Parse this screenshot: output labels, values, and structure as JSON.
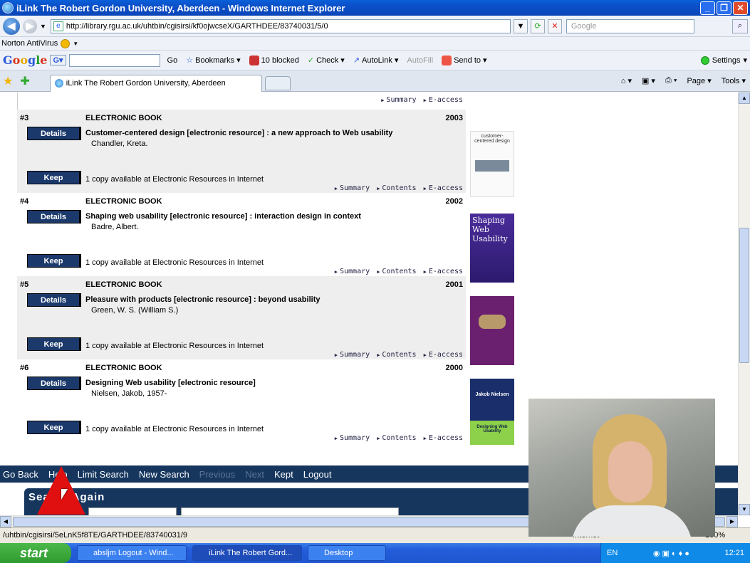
{
  "window": {
    "title": "iLink The Robert Gordon University, Aberdeen - Windows Internet Explorer"
  },
  "address": {
    "url": "http://library.rgu.ac.uk/uhtbin/cgisirsi/kf0ojwcseX/GARTHDEE/83740031/5/0",
    "search_placeholder": "Google"
  },
  "norton": {
    "label": "Norton AntiVirus"
  },
  "google_toolbar": {
    "go": "Go",
    "bookmarks": "Bookmarks",
    "blocked": "10 blocked",
    "check": "Check",
    "autolink": "AutoLink",
    "autofill": "AutoFill",
    "sendto": "Send to",
    "settings": "Settings"
  },
  "tab": {
    "label": "iLink The Robert Gordon University, Aberdeen"
  },
  "commandbar": {
    "page": "Page",
    "tools": "Tools"
  },
  "top_links": [
    "Summary",
    "E-access"
  ],
  "results": [
    {
      "num": "#3",
      "type": "ELECTRONIC BOOK",
      "year": "2003",
      "title": "Customer-centered design [electronic resource] : a new approach to Web usability",
      "author": "Chandler, Kreta.",
      "availability": "1 copy available at Electronic Resources in Internet",
      "links": [
        "Summary",
        "Contents",
        "E-access"
      ],
      "cover_text": "customer-centered design"
    },
    {
      "num": "#4",
      "type": "ELECTRONIC BOOK",
      "year": "2002",
      "title": "Shaping web usability [electronic resource] : interaction design in context",
      "author": "Badre, Albert.",
      "availability": "1 copy available at Electronic Resources in Internet",
      "links": [
        "Summary",
        "Contents",
        "E-access"
      ],
      "cover_text": "Shaping Web Usability"
    },
    {
      "num": "#5",
      "type": "ELECTRONIC BOOK",
      "year": "2001",
      "title": "Pleasure with products [electronic resource] : beyond usability",
      "author": "Green, W. S. (William S.)",
      "availability": "1 copy available at Electronic Resources in Internet",
      "links": [
        "Summary",
        "Contents",
        "E-access"
      ],
      "cover_text": ""
    },
    {
      "num": "#6",
      "type": "ELECTRONIC BOOK",
      "year": "2000",
      "title": "Designing Web usability [electronic resource]",
      "author": "Nielsen, Jakob, 1957-",
      "availability": "1 copy available at Electronic Resources in Internet",
      "links": [
        "Summary",
        "Contents",
        "E-access"
      ],
      "cover_text": "Jakob Nielsen",
      "cover_subtext": "Designing Web Usability"
    }
  ],
  "buttons": {
    "details": "Details",
    "keep": "Keep"
  },
  "nav": {
    "go_back": "Go Back",
    "help": "Help",
    "limit_search": "Limit Search",
    "new_search": "New Search",
    "previous": "Previous",
    "next": "Next",
    "kept": "Kept",
    "logout": "Logout"
  },
  "search_again": {
    "title": "Search Again"
  },
  "status": {
    "text": "/uhtbin/cgisirsi/5eLnK5f8TE/GARTHDEE/83740031/9",
    "zone": "Internet",
    "zoom": "100%"
  },
  "taskbar": {
    "start": "start",
    "tasks": [
      "absljm Logout - Wind...",
      "iLink The Robert Gord...",
      "Desktop"
    ],
    "lang": "EN",
    "clock": "12:21"
  },
  "colors": {
    "navy": "#16365e",
    "title_blue": "#0a5fd8",
    "pointer_red": "#e01010"
  }
}
